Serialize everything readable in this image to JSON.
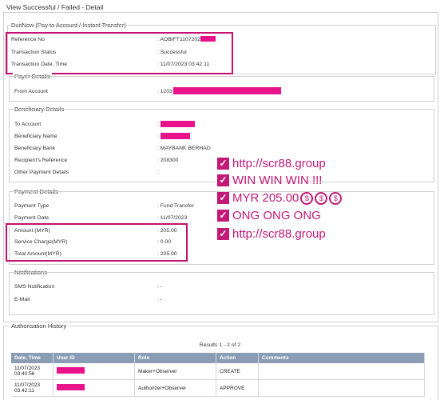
{
  "page_title": "View Successful / Failed - Detail",
  "duitnow": {
    "legend": "DuitNow (Pay to Account / Instant Transfer)",
    "rows": [
      {
        "label": "Reference No",
        "value": ": AOBIFT11072023"
      },
      {
        "label": "Transaction Status",
        "value": ": Successful"
      },
      {
        "label": "Transaction Date, Time",
        "value": ": 11/07/2023 03:42:11"
      }
    ]
  },
  "payer": {
    "legend": "Payer Details",
    "from_label": "From Account",
    "from_value": ": 1203"
  },
  "beneficiary": {
    "legend": "Beneficiary Details",
    "rows": [
      {
        "label": "To Account",
        "value": ":"
      },
      {
        "label": "Beneficiary Name",
        "value": ":"
      },
      {
        "label": "Beneficiary Bank",
        "value": ": MAYBANK BERHAD"
      },
      {
        "label": "Recipient's Reference",
        "value": ": 208300"
      },
      {
        "label": "Other Payment Details",
        "value": ":"
      }
    ]
  },
  "payment": {
    "legend": "Payment Details",
    "rows": [
      {
        "label": "Payment Type",
        "value": ": Fund Transfer"
      },
      {
        "label": "Payment Date",
        "value": ": 11/07/2023"
      },
      {
        "label": "Amount (MYR)",
        "value": ": 205.00"
      },
      {
        "label": "Service Charge(MYR)",
        "value": ": 0.00"
      },
      {
        "label": "Total Amount(MYR)",
        "value": ": 205.00"
      }
    ]
  },
  "notifications": {
    "legend": "Notifications",
    "rows": [
      {
        "label": "SMS Notification",
        "value": ": -"
      },
      {
        "label": "E-Mail",
        "value": ": -"
      }
    ]
  },
  "promo": {
    "lines": [
      "http://scr88.group",
      "WIN WIN WIN !!!",
      "MYR 205.00",
      "ONG ONG ONG",
      "http://scr88.group"
    ],
    "check_glyph": "✓",
    "coin_glyph": "$",
    "color": "#c21877"
  },
  "authorisation": {
    "legend": "Authorisation History",
    "results": "Results 1 - 2 of 2",
    "columns": [
      "Date, Time",
      "User ID",
      "Role",
      "Action",
      "Comments"
    ],
    "rows": [
      {
        "date": "11/07/2023",
        "time": "03:40:56",
        "role": "Maker+Observer",
        "action": "CREATE",
        "comments": ""
      },
      {
        "date": "11/07/2023",
        "time": "03:42:11",
        "role": "Authorizer+Observer",
        "action": "APPROVE",
        "comments": ""
      }
    ]
  },
  "colors": {
    "redaction": "#e8138a",
    "highlight": "#c4106f",
    "table_header": "#8a9db4"
  }
}
